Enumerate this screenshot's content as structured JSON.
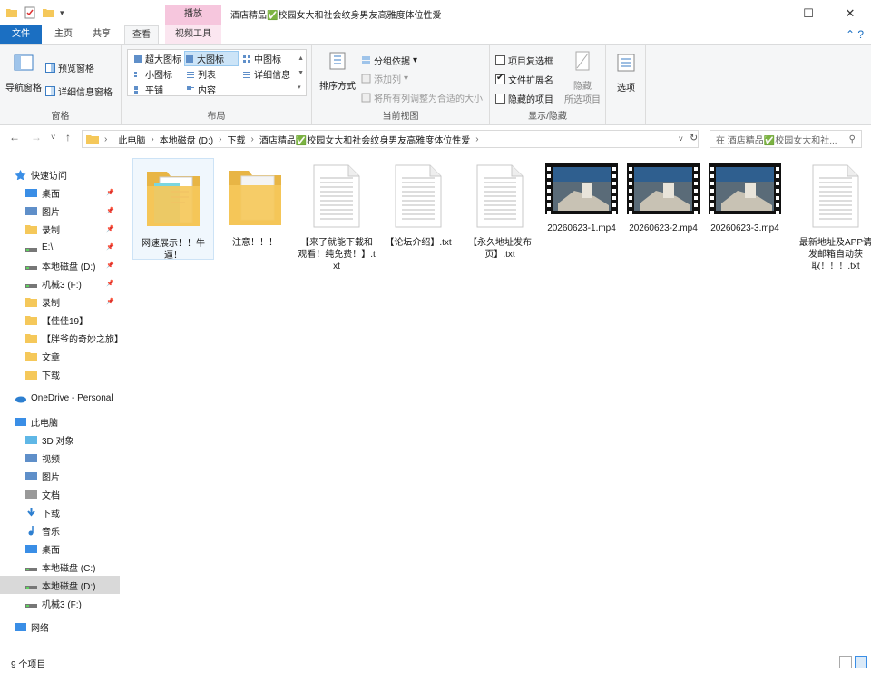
{
  "titlebar": {
    "context_tab": "播放",
    "title": "酒店精品✅校园女大和社会纹身男友高雅度体位性爱",
    "minimize": "—",
    "maximize": "☐",
    "close": "✕"
  },
  "ribbon_tabs": {
    "file": "文件",
    "home": "主页",
    "share": "共享",
    "view": "查看",
    "video_tools": "视频工具"
  },
  "ribbon": {
    "panes": {
      "nav_pane": "导航窗格",
      "preview_pane": "预览窗格",
      "details_pane": "详细信息窗格",
      "label": "窗格"
    },
    "layout": {
      "xl_icons": "超大图标",
      "large_icons": "大图标",
      "medium_icons": "中图标",
      "small_icons": "小图标",
      "list": "列表",
      "details": "详细信息",
      "tiles": "平铺",
      "content": "内容",
      "label": "布局"
    },
    "current_view": {
      "sort_by": "排序方式",
      "group_by": "分组依据",
      "add_columns": "添加列",
      "size_all_columns": "将所有列调整为合适的大小",
      "label": "当前视图"
    },
    "show_hide": {
      "item_checkboxes": "项目复选框",
      "item_checkboxes_checked": false,
      "file_extensions": "文件扩展名",
      "file_extensions_checked": true,
      "hidden_items": "隐藏的项目",
      "hidden_items_checked": false,
      "hide_selected": "隐藏",
      "hide_selected_sub": "所选项目",
      "label": "显示/隐藏"
    },
    "options": "选项"
  },
  "nav": {
    "back": "←",
    "forward": "→",
    "recent": "˅",
    "up": "↑",
    "breadcrumbs": [
      "此电脑",
      "本地磁盘 (D:)",
      "下载",
      "酒店精品✅校园女大和社会纹身男友高雅度体位性爱"
    ],
    "refresh": "↻",
    "search_placeholder": "在 酒店精品✅校园女大和社..."
  },
  "sidebar": {
    "items": [
      {
        "label": "快速访问",
        "icon": "star-icon",
        "pinned": false
      },
      {
        "label": "桌面",
        "icon": "desktop-icon",
        "pinned": true
      },
      {
        "label": "图片",
        "icon": "pictures-icon",
        "pinned": true
      },
      {
        "label": "录制",
        "icon": "folder-icon",
        "pinned": true
      },
      {
        "label": "E:\\",
        "icon": "drive-icon",
        "pinned": true
      },
      {
        "label": "本地磁盘 (D:)",
        "icon": "drive-icon",
        "pinned": true
      },
      {
        "label": "机械3 (F:)",
        "icon": "drive-icon",
        "pinned": true
      },
      {
        "label": "录制",
        "icon": "folder-icon",
        "pinned": true
      },
      {
        "label": "【佳佳19】",
        "icon": "folder-icon",
        "pinned": false
      },
      {
        "label": "【胖爷的奇妙之旅】",
        "icon": "folder-icon",
        "pinned": false
      },
      {
        "label": "文章",
        "icon": "folder-icon",
        "pinned": false
      },
      {
        "label": "下载",
        "icon": "folder-icon",
        "pinned": false
      },
      {
        "label": "OneDrive - Personal",
        "icon": "cloud-icon",
        "pinned": false
      },
      {
        "label": "此电脑",
        "icon": "computer-icon",
        "pinned": false
      },
      {
        "label": "3D 对象",
        "icon": "cube-icon",
        "pinned": false
      },
      {
        "label": "视频",
        "icon": "video-icon",
        "pinned": false
      },
      {
        "label": "图片",
        "icon": "pictures-icon",
        "pinned": false
      },
      {
        "label": "文档",
        "icon": "document-icon",
        "pinned": false
      },
      {
        "label": "下载",
        "icon": "download-icon",
        "pinned": false
      },
      {
        "label": "音乐",
        "icon": "music-icon",
        "pinned": false
      },
      {
        "label": "桌面",
        "icon": "desktop-icon",
        "pinned": false
      },
      {
        "label": "本地磁盘 (C:)",
        "icon": "drive-icon",
        "pinned": false
      },
      {
        "label": "本地磁盘 (D:)",
        "icon": "drive-icon",
        "pinned": false
      },
      {
        "label": "机械3 (F:)",
        "icon": "drive-icon",
        "pinned": false
      },
      {
        "label": "网络",
        "icon": "network-icon",
        "pinned": false
      }
    ]
  },
  "files": [
    {
      "label": "网速展示！！牛逼！",
      "type": "folder-open"
    },
    {
      "label": "注意！！！",
      "type": "folder"
    },
    {
      "label": "【来了就能下载和观看！纯免费！】.txt",
      "type": "text"
    },
    {
      "label": "【论坛介绍】.txt",
      "type": "text"
    },
    {
      "label": "【永久地址发布页】.txt",
      "type": "text"
    },
    {
      "label": "20260623-1.mp4",
      "type": "video"
    },
    {
      "label": "20260623-2.mp4",
      "type": "video"
    },
    {
      "label": "20260623-3.mp4",
      "type": "video"
    },
    {
      "label": "最新地址及APP请发邮箱自动获取！！！.txt",
      "type": "text"
    }
  ],
  "status": {
    "item_count": "9 个项目"
  },
  "colors": {
    "accent": "#1b6fc2",
    "folder": "#f5c85a",
    "context_tab": "#f6c6dd"
  }
}
